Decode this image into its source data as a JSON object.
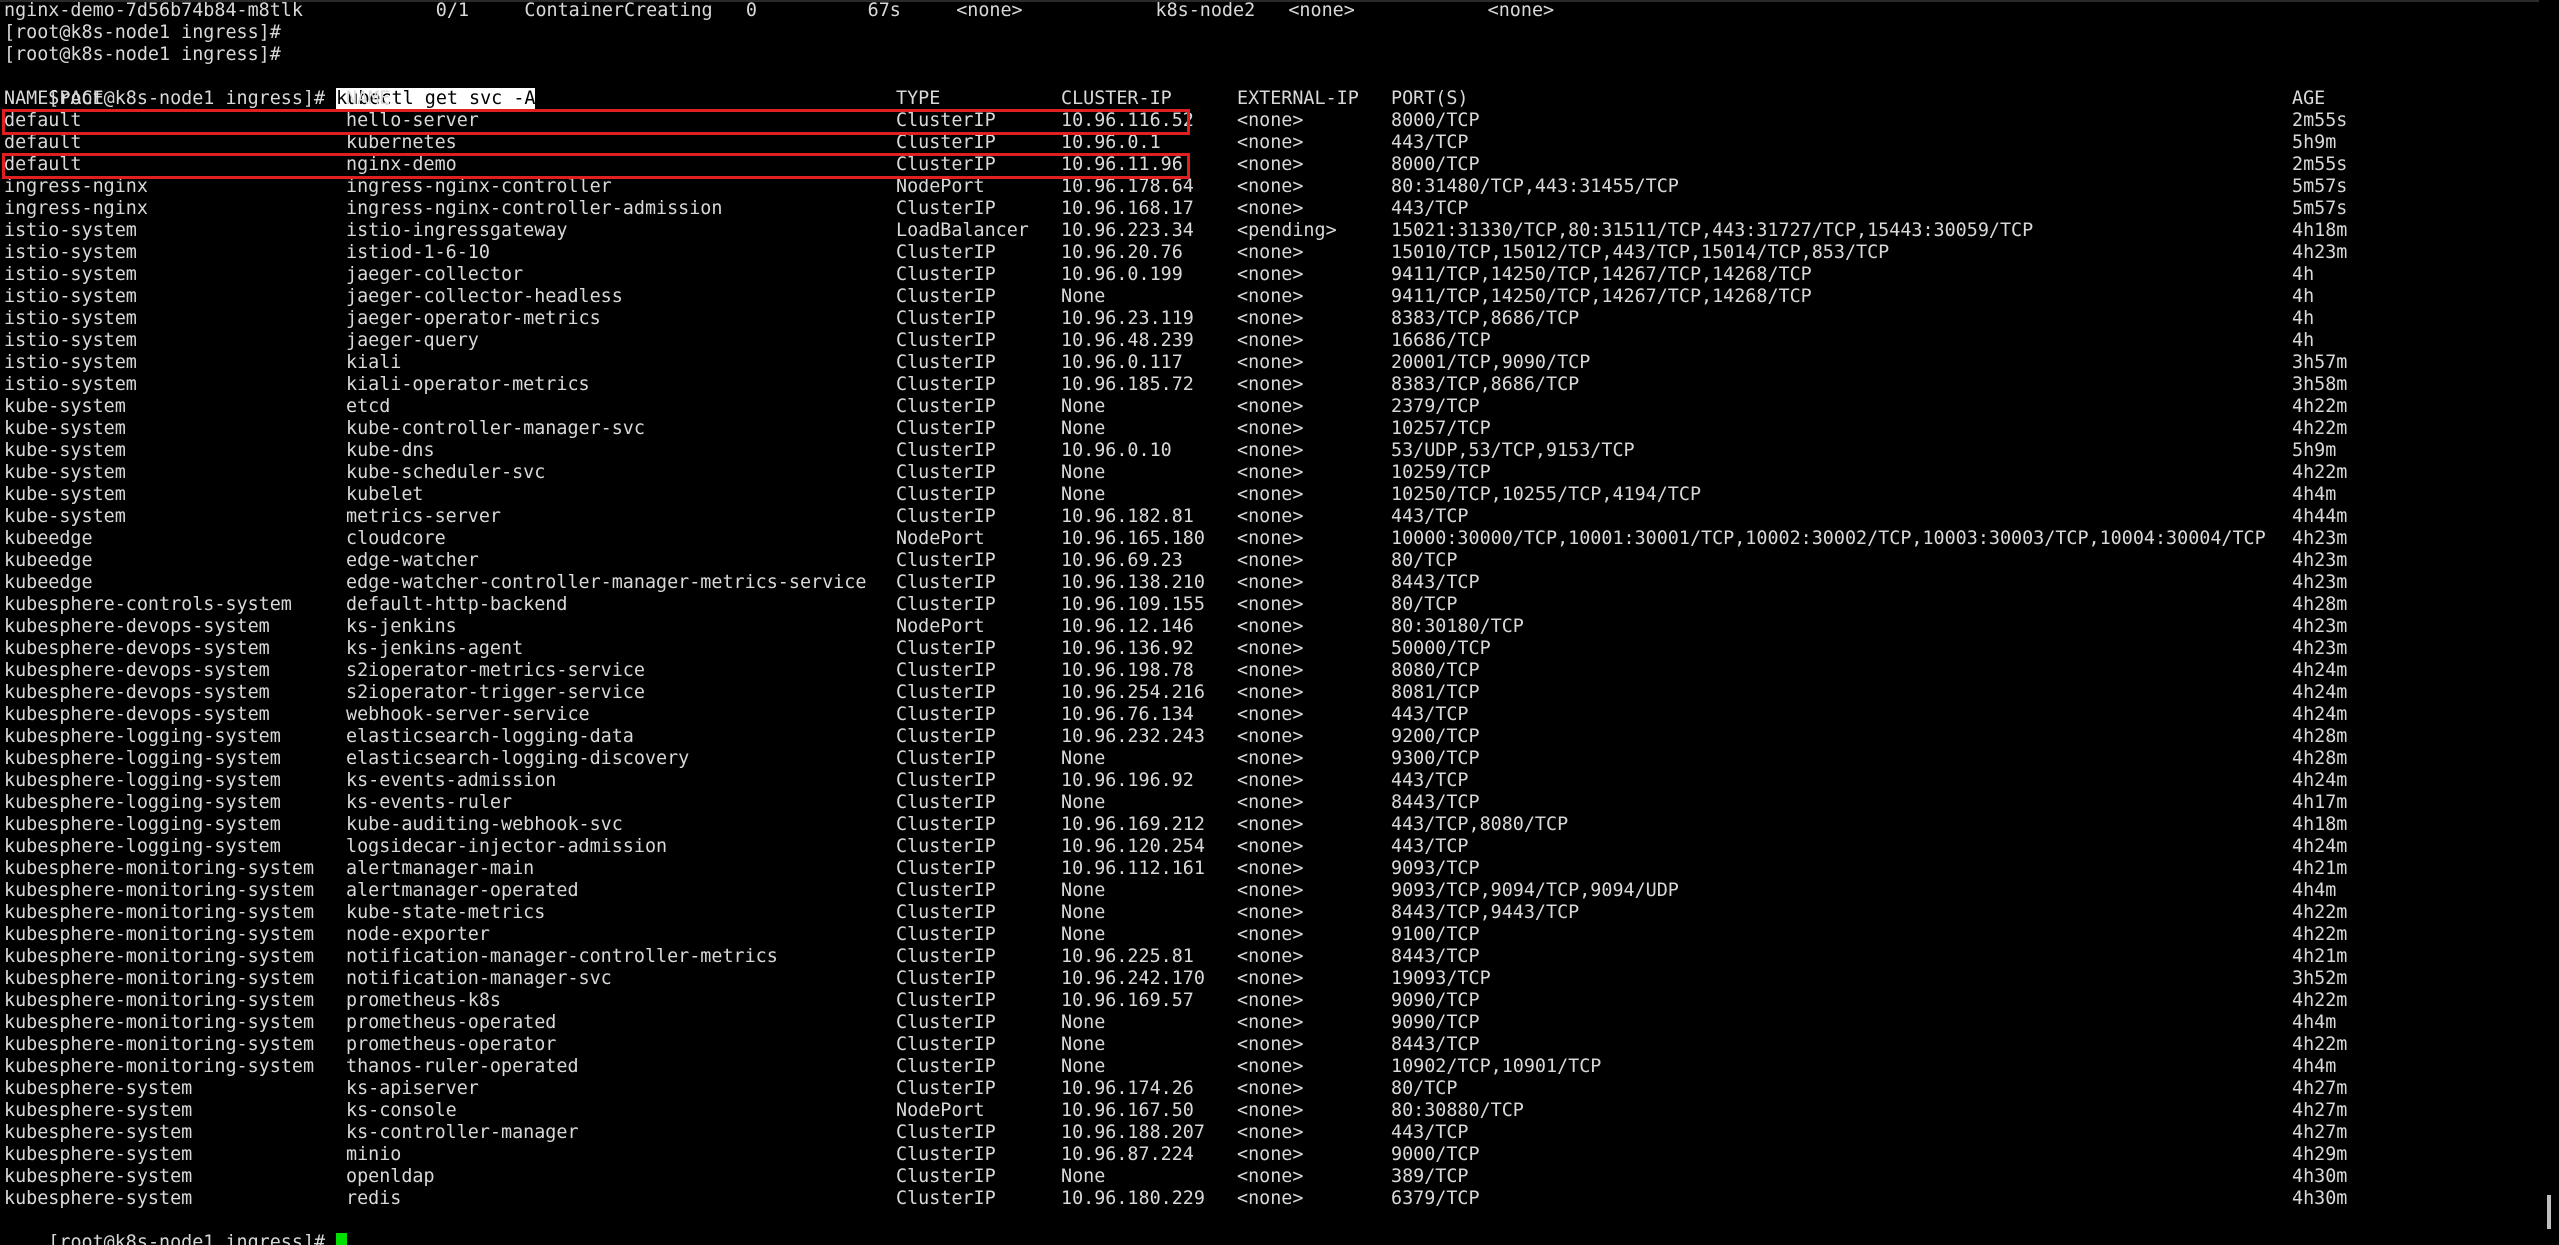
{
  "terminal": {
    "pre_lines": [
      {
        "text": "nginx-demo-7d56b74b84-m8tlk            0/1     ContainerCreating   0          67s     <none>            k8s-node2   <none>            <none>"
      },
      {
        "text": "[root@k8s-node1 ingress]#"
      },
      {
        "text": "[root@k8s-node1 ingress]#"
      }
    ],
    "prompt": "[root@k8s-node1 ingress]# ",
    "command": "kubectl get svc -A",
    "headers": [
      "NAMESPACE",
      "NAME",
      "TYPE",
      "CLUSTER-IP",
      "EXTERNAL-IP",
      "PORT(S)",
      "AGE"
    ],
    "rows": [
      [
        "default",
        "hello-server",
        "ClusterIP",
        "10.96.116.52",
        "<none>",
        "8000/TCP",
        "2m55s"
      ],
      [
        "default",
        "kubernetes",
        "ClusterIP",
        "10.96.0.1",
        "<none>",
        "443/TCP",
        "5h9m"
      ],
      [
        "default",
        "nginx-demo",
        "ClusterIP",
        "10.96.11.96",
        "<none>",
        "8000/TCP",
        "2m55s"
      ],
      [
        "ingress-nginx",
        "ingress-nginx-controller",
        "NodePort",
        "10.96.178.64",
        "<none>",
        "80:31480/TCP,443:31455/TCP",
        "5m57s"
      ],
      [
        "ingress-nginx",
        "ingress-nginx-controller-admission",
        "ClusterIP",
        "10.96.168.17",
        "<none>",
        "443/TCP",
        "5m57s"
      ],
      [
        "istio-system",
        "istio-ingressgateway",
        "LoadBalancer",
        "10.96.223.34",
        "<pending>",
        "15021:31330/TCP,80:31511/TCP,443:31727/TCP,15443:30059/TCP",
        "4h18m"
      ],
      [
        "istio-system",
        "istiod-1-6-10",
        "ClusterIP",
        "10.96.20.76",
        "<none>",
        "15010/TCP,15012/TCP,443/TCP,15014/TCP,853/TCP",
        "4h23m"
      ],
      [
        "istio-system",
        "jaeger-collector",
        "ClusterIP",
        "10.96.0.199",
        "<none>",
        "9411/TCP,14250/TCP,14267/TCP,14268/TCP",
        "4h"
      ],
      [
        "istio-system",
        "jaeger-collector-headless",
        "ClusterIP",
        "None",
        "<none>",
        "9411/TCP,14250/TCP,14267/TCP,14268/TCP",
        "4h"
      ],
      [
        "istio-system",
        "jaeger-operator-metrics",
        "ClusterIP",
        "10.96.23.119",
        "<none>",
        "8383/TCP,8686/TCP",
        "4h"
      ],
      [
        "istio-system",
        "jaeger-query",
        "ClusterIP",
        "10.96.48.239",
        "<none>",
        "16686/TCP",
        "4h"
      ],
      [
        "istio-system",
        "kiali",
        "ClusterIP",
        "10.96.0.117",
        "<none>",
        "20001/TCP,9090/TCP",
        "3h57m"
      ],
      [
        "istio-system",
        "kiali-operator-metrics",
        "ClusterIP",
        "10.96.185.72",
        "<none>",
        "8383/TCP,8686/TCP",
        "3h58m"
      ],
      [
        "kube-system",
        "etcd",
        "ClusterIP",
        "None",
        "<none>",
        "2379/TCP",
        "4h22m"
      ],
      [
        "kube-system",
        "kube-controller-manager-svc",
        "ClusterIP",
        "None",
        "<none>",
        "10257/TCP",
        "4h22m"
      ],
      [
        "kube-system",
        "kube-dns",
        "ClusterIP",
        "10.96.0.10",
        "<none>",
        "53/UDP,53/TCP,9153/TCP",
        "5h9m"
      ],
      [
        "kube-system",
        "kube-scheduler-svc",
        "ClusterIP",
        "None",
        "<none>",
        "10259/TCP",
        "4h22m"
      ],
      [
        "kube-system",
        "kubelet",
        "ClusterIP",
        "None",
        "<none>",
        "10250/TCP,10255/TCP,4194/TCP",
        "4h4m"
      ],
      [
        "kube-system",
        "metrics-server",
        "ClusterIP",
        "10.96.182.81",
        "<none>",
        "443/TCP",
        "4h44m"
      ],
      [
        "kubeedge",
        "cloudcore",
        "NodePort",
        "10.96.165.180",
        "<none>",
        "10000:30000/TCP,10001:30001/TCP,10002:30002/TCP,10003:30003/TCP,10004:30004/TCP",
        "4h23m"
      ],
      [
        "kubeedge",
        "edge-watcher",
        "ClusterIP",
        "10.96.69.23",
        "<none>",
        "80/TCP",
        "4h23m"
      ],
      [
        "kubeedge",
        "edge-watcher-controller-manager-metrics-service",
        "ClusterIP",
        "10.96.138.210",
        "<none>",
        "8443/TCP",
        "4h23m"
      ],
      [
        "kubesphere-controls-system",
        "default-http-backend",
        "ClusterIP",
        "10.96.109.155",
        "<none>",
        "80/TCP",
        "4h28m"
      ],
      [
        "kubesphere-devops-system",
        "ks-jenkins",
        "NodePort",
        "10.96.12.146",
        "<none>",
        "80:30180/TCP",
        "4h23m"
      ],
      [
        "kubesphere-devops-system",
        "ks-jenkins-agent",
        "ClusterIP",
        "10.96.136.92",
        "<none>",
        "50000/TCP",
        "4h23m"
      ],
      [
        "kubesphere-devops-system",
        "s2ioperator-metrics-service",
        "ClusterIP",
        "10.96.198.78",
        "<none>",
        "8080/TCP",
        "4h24m"
      ],
      [
        "kubesphere-devops-system",
        "s2ioperator-trigger-service",
        "ClusterIP",
        "10.96.254.216",
        "<none>",
        "8081/TCP",
        "4h24m"
      ],
      [
        "kubesphere-devops-system",
        "webhook-server-service",
        "ClusterIP",
        "10.96.76.134",
        "<none>",
        "443/TCP",
        "4h24m"
      ],
      [
        "kubesphere-logging-system",
        "elasticsearch-logging-data",
        "ClusterIP",
        "10.96.232.243",
        "<none>",
        "9200/TCP",
        "4h28m"
      ],
      [
        "kubesphere-logging-system",
        "elasticsearch-logging-discovery",
        "ClusterIP",
        "None",
        "<none>",
        "9300/TCP",
        "4h28m"
      ],
      [
        "kubesphere-logging-system",
        "ks-events-admission",
        "ClusterIP",
        "10.96.196.92",
        "<none>",
        "443/TCP",
        "4h24m"
      ],
      [
        "kubesphere-logging-system",
        "ks-events-ruler",
        "ClusterIP",
        "None",
        "<none>",
        "8443/TCP",
        "4h17m"
      ],
      [
        "kubesphere-logging-system",
        "kube-auditing-webhook-svc",
        "ClusterIP",
        "10.96.169.212",
        "<none>",
        "443/TCP,8080/TCP",
        "4h18m"
      ],
      [
        "kubesphere-logging-system",
        "logsidecar-injector-admission",
        "ClusterIP",
        "10.96.120.254",
        "<none>",
        "443/TCP",
        "4h24m"
      ],
      [
        "kubesphere-monitoring-system",
        "alertmanager-main",
        "ClusterIP",
        "10.96.112.161",
        "<none>",
        "9093/TCP",
        "4h21m"
      ],
      [
        "kubesphere-monitoring-system",
        "alertmanager-operated",
        "ClusterIP",
        "None",
        "<none>",
        "9093/TCP,9094/TCP,9094/UDP",
        "4h4m"
      ],
      [
        "kubesphere-monitoring-system",
        "kube-state-metrics",
        "ClusterIP",
        "None",
        "<none>",
        "8443/TCP,9443/TCP",
        "4h22m"
      ],
      [
        "kubesphere-monitoring-system",
        "node-exporter",
        "ClusterIP",
        "None",
        "<none>",
        "9100/TCP",
        "4h22m"
      ],
      [
        "kubesphere-monitoring-system",
        "notification-manager-controller-metrics",
        "ClusterIP",
        "10.96.225.81",
        "<none>",
        "8443/TCP",
        "4h21m"
      ],
      [
        "kubesphere-monitoring-system",
        "notification-manager-svc",
        "ClusterIP",
        "10.96.242.170",
        "<none>",
        "19093/TCP",
        "3h52m"
      ],
      [
        "kubesphere-monitoring-system",
        "prometheus-k8s",
        "ClusterIP",
        "10.96.169.57",
        "<none>",
        "9090/TCP",
        "4h22m"
      ],
      [
        "kubesphere-monitoring-system",
        "prometheus-operated",
        "ClusterIP",
        "None",
        "<none>",
        "9090/TCP",
        "4h4m"
      ],
      [
        "kubesphere-monitoring-system",
        "prometheus-operator",
        "ClusterIP",
        "None",
        "<none>",
        "8443/TCP",
        "4h22m"
      ],
      [
        "kubesphere-monitoring-system",
        "thanos-ruler-operated",
        "ClusterIP",
        "None",
        "<none>",
        "10902/TCP,10901/TCP",
        "4h4m"
      ],
      [
        "kubesphere-system",
        "ks-apiserver",
        "ClusterIP",
        "10.96.174.26",
        "<none>",
        "80/TCP",
        "4h27m"
      ],
      [
        "kubesphere-system",
        "ks-console",
        "NodePort",
        "10.96.167.50",
        "<none>",
        "80:30880/TCP",
        "4h27m"
      ],
      [
        "kubesphere-system",
        "ks-controller-manager",
        "ClusterIP",
        "10.96.188.207",
        "<none>",
        "443/TCP",
        "4h27m"
      ],
      [
        "kubesphere-system",
        "minio",
        "ClusterIP",
        "10.96.87.224",
        "<none>",
        "9000/TCP",
        "4h29m"
      ],
      [
        "kubesphere-system",
        "openldap",
        "ClusterIP",
        "None",
        "<none>",
        "389/TCP",
        "4h30m"
      ],
      [
        "kubesphere-system",
        "redis",
        "ClusterIP",
        "10.96.180.229",
        "<none>",
        "6379/TCP",
        "4h30m"
      ]
    ],
    "highlighted_rows": [
      0,
      2
    ],
    "final_prompt": "[root@k8s-node1 ingress]#",
    "colors": {
      "background": "#000000",
      "text": "#d9d9d9",
      "highlight_border": "#e02020",
      "cursor": "#00e000"
    }
  }
}
